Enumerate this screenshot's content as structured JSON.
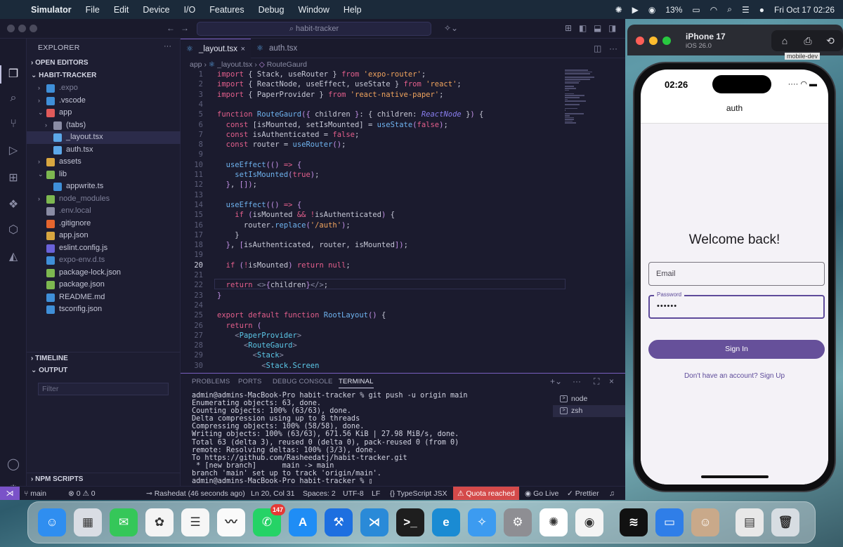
{
  "menubar": {
    "items": [
      "Simulator",
      "File",
      "Edit",
      "Device",
      "I/O",
      "Features",
      "Debug",
      "Window",
      "Help"
    ],
    "battery": "13%",
    "datetime": "Fri Oct 17  02:26"
  },
  "vscode": {
    "search": "habit-tracker",
    "explorer_title": "EXPLORER",
    "sections": {
      "open_editors": "OPEN EDITORS",
      "project": "HABIT-TRACKER",
      "timeline": "TIMELINE",
      "output": "OUTPUT",
      "npm": "NPM SCRIPTS"
    },
    "filter_placeholder": "Filter",
    "tree": [
      {
        "label": ".expo",
        "indent": 1,
        "chev": "›",
        "icon": "folder-icon",
        "color": "#3f8fd8",
        "dim": true
      },
      {
        "label": ".vscode",
        "indent": 1,
        "chev": "›",
        "icon": "folder-icon",
        "color": "#3f8fd8",
        "dim": false
      },
      {
        "label": "app",
        "indent": 1,
        "chev": "⌄",
        "icon": "folder-icon",
        "color": "#e05a5a",
        "dim": false
      },
      {
        "label": "(tabs)",
        "indent": 2,
        "chev": "›",
        "icon": "folder-icon",
        "color": "#8a8ca4",
        "dim": false
      },
      {
        "label": "_layout.tsx",
        "indent": 2,
        "chev": "",
        "icon": "react-icon",
        "color": "#5ca7e8",
        "dim": false,
        "selected": true
      },
      {
        "label": "auth.tsx",
        "indent": 2,
        "chev": "",
        "icon": "react-icon",
        "color": "#5ca7e8",
        "dim": false
      },
      {
        "label": "assets",
        "indent": 1,
        "chev": "›",
        "icon": "folder-icon",
        "color": "#d8a640",
        "dim": false
      },
      {
        "label": "lib",
        "indent": 1,
        "chev": "⌄",
        "icon": "folder-icon",
        "color": "#7db850",
        "dim": false
      },
      {
        "label": "appwrite.ts",
        "indent": 2,
        "chev": "",
        "icon": "ts-icon",
        "color": "#3f8fd8",
        "dim": false
      },
      {
        "label": "node_modules",
        "indent": 1,
        "chev": "›",
        "icon": "folder-icon",
        "color": "#7db850",
        "dim": true
      },
      {
        "label": ".env.local",
        "indent": 1,
        "chev": "",
        "icon": "env-icon",
        "color": "#8a8ca4",
        "dim": true
      },
      {
        "label": ".gitignore",
        "indent": 1,
        "chev": "",
        "icon": "git-icon",
        "color": "#e5652e",
        "dim": false
      },
      {
        "label": "app.json",
        "indent": 1,
        "chev": "",
        "icon": "json-icon",
        "color": "#d8a640",
        "dim": false
      },
      {
        "label": "eslint.config.js",
        "indent": 1,
        "chev": "",
        "icon": "eslint-icon",
        "color": "#6a62d8",
        "dim": false
      },
      {
        "label": "expo-env.d.ts",
        "indent": 1,
        "chev": "",
        "icon": "ts-icon",
        "color": "#3f8fd8",
        "dim": true
      },
      {
        "label": "package-lock.json",
        "indent": 1,
        "chev": "",
        "icon": "npm-icon",
        "color": "#7db850",
        "dim": false
      },
      {
        "label": "package.json",
        "indent": 1,
        "chev": "",
        "icon": "npm-icon",
        "color": "#7db850",
        "dim": false
      },
      {
        "label": "README.md",
        "indent": 1,
        "chev": "",
        "icon": "info-icon",
        "color": "#3f8fd8",
        "dim": false
      },
      {
        "label": "tsconfig.json",
        "indent": 1,
        "chev": "",
        "icon": "tsconfig-icon",
        "color": "#3f8fd8",
        "dim": false
      }
    ],
    "tabs": [
      {
        "label": "_layout.tsx",
        "active": true
      },
      {
        "label": "auth.tsx",
        "active": false
      }
    ],
    "breadcrumb": {
      "a": "app",
      "b": "_layout.tsx",
      "c": "RouteGaurd"
    },
    "code": [
      [
        [
          "k",
          "import "
        ],
        [
          "v",
          "{ "
        ],
        [
          "v",
          "Stack"
        ],
        [
          "v",
          ", "
        ],
        [
          "v",
          "useRouter"
        ],
        [
          "v",
          " } "
        ],
        [
          "k",
          "from "
        ],
        [
          "s",
          "'expo-router'"
        ],
        [
          "v",
          ";"
        ]
      ],
      [
        [
          "k",
          "import "
        ],
        [
          "v",
          "{ ReactNode, useEffect, useState } "
        ],
        [
          "k",
          "from "
        ],
        [
          "s",
          "'react'"
        ],
        [
          "v",
          ";"
        ]
      ],
      [
        [
          "k",
          "import "
        ],
        [
          "v",
          "{ PaperProvider } "
        ],
        [
          "k",
          "from "
        ],
        [
          "s",
          "'react-native-paper'"
        ],
        [
          "v",
          ";"
        ]
      ],
      [],
      [
        [
          "k",
          "function "
        ],
        [
          "f",
          "RouteGaurd"
        ],
        [
          "b",
          "({ "
        ],
        [
          "v",
          "children "
        ],
        [
          "b",
          "}"
        ],
        [
          "v",
          ": { children: "
        ],
        [
          "t",
          "ReactNode"
        ],
        [
          "v",
          " }"
        ],
        [
          "b",
          ")"
        ],
        [
          "v",
          " {"
        ]
      ],
      [
        [
          "v",
          "  "
        ],
        [
          "k",
          "const "
        ],
        [
          "v",
          "[isMounted, setIsMounted] = "
        ],
        [
          "f",
          "useState"
        ],
        [
          "b",
          "("
        ],
        [
          "k",
          "false"
        ],
        [
          "b",
          ")"
        ],
        [
          "v",
          ";"
        ]
      ],
      [
        [
          "v",
          "  "
        ],
        [
          "k",
          "const "
        ],
        [
          "v",
          "isAuthenticated = "
        ],
        [
          "k",
          "false"
        ],
        [
          "v",
          ";"
        ]
      ],
      [
        [
          "v",
          "  "
        ],
        [
          "k",
          "const "
        ],
        [
          "v",
          "router = "
        ],
        [
          "f",
          "useRouter"
        ],
        [
          "b",
          "()"
        ],
        [
          "v",
          ";"
        ]
      ],
      [],
      [
        [
          "v",
          "  "
        ],
        [
          "f",
          "useEffect"
        ],
        [
          "b",
          "(() "
        ],
        [
          "k",
          "=> "
        ],
        [
          "b",
          "{"
        ]
      ],
      [
        [
          "v",
          "    "
        ],
        [
          "f",
          "setIsMounted"
        ],
        [
          "b",
          "("
        ],
        [
          "k",
          "true"
        ],
        [
          "b",
          ")"
        ],
        [
          "v",
          ";"
        ]
      ],
      [
        [
          "v",
          "  "
        ],
        [
          "b",
          "}"
        ],
        [
          "v",
          ", "
        ],
        [
          "b",
          "[]"
        ],
        [
          "b",
          ")"
        ],
        [
          "v",
          ";"
        ]
      ],
      [],
      [
        [
          "v",
          "  "
        ],
        [
          "f",
          "useEffect"
        ],
        [
          "b",
          "(() "
        ],
        [
          "k",
          "=> "
        ],
        [
          "b",
          "{"
        ]
      ],
      [
        [
          "v",
          "    "
        ],
        [
          "k",
          "if "
        ],
        [
          "b",
          "("
        ],
        [
          "v",
          "isMounted "
        ],
        [
          "k",
          "&& "
        ],
        [
          "k",
          "!"
        ],
        [
          "v",
          "isAuthenticated"
        ],
        [
          "b",
          ")"
        ],
        [
          "v",
          " {"
        ]
      ],
      [
        [
          "v",
          "      router."
        ],
        [
          "f",
          "replace"
        ],
        [
          "b",
          "("
        ],
        [
          "s",
          "'/auth'"
        ],
        [
          "b",
          ")"
        ],
        [
          "v",
          ";"
        ]
      ],
      [
        [
          "v",
          "    }"
        ]
      ],
      [
        [
          "v",
          "  "
        ],
        [
          "b",
          "}"
        ],
        [
          "v",
          ", "
        ],
        [
          "b",
          "["
        ],
        [
          "v",
          "isAuthenticated, router, isMounted"
        ],
        [
          "b",
          "]"
        ],
        [
          "b",
          ")"
        ],
        [
          "v",
          ";"
        ]
      ],
      [],
      [
        [
          "v",
          "  "
        ],
        [
          "k",
          "if "
        ],
        [
          "b",
          "("
        ],
        [
          "k",
          "!"
        ],
        [
          "v",
          "isMounted"
        ],
        [
          "b",
          ")"
        ],
        [
          "v",
          " "
        ],
        [
          "k",
          "return "
        ],
        [
          "k",
          "null"
        ],
        [
          "v",
          ";"
        ]
      ],
      [],
      [
        [
          "v",
          "  "
        ],
        [
          "k",
          "return "
        ],
        [
          "p",
          "<>"
        ],
        [
          "b",
          "{"
        ],
        [
          "v",
          "children"
        ],
        [
          "b",
          "}"
        ],
        [
          "p",
          "</>"
        ],
        [
          "v",
          ";"
        ]
      ],
      [
        [
          "b",
          "}"
        ]
      ],
      [],
      [
        [
          "k",
          "export "
        ],
        [
          "k",
          "default "
        ],
        [
          "k",
          "function "
        ],
        [
          "f",
          "RootLayout"
        ],
        [
          "b",
          "()"
        ],
        [
          "v",
          " {"
        ]
      ],
      [
        [
          "v",
          "  "
        ],
        [
          "k",
          "return "
        ],
        [
          "b",
          "("
        ]
      ],
      [
        [
          "v",
          "    "
        ],
        [
          "p",
          "<"
        ],
        [
          "tg",
          "PaperProvider"
        ],
        [
          "p",
          ">"
        ]
      ],
      [
        [
          "v",
          "      "
        ],
        [
          "p",
          "<"
        ],
        [
          "tg",
          "RouteGaurd"
        ],
        [
          "p",
          ">"
        ]
      ],
      [
        [
          "v",
          "        "
        ],
        [
          "p",
          "<"
        ],
        [
          "tg",
          "Stack"
        ],
        [
          "p",
          ">"
        ]
      ],
      [
        [
          "v",
          "          "
        ],
        [
          "p",
          "<"
        ],
        [
          "tg",
          "Stack.Screen"
        ]
      ]
    ],
    "current_line": 20,
    "panel_tabs": [
      "PROBLEMS",
      "PORTS",
      "DEBUG CONSOLE",
      "TERMINAL"
    ],
    "terminal": [
      "admin@admins-MacBook-Pro habit-tracker % git push -u origin main",
      "Enumerating objects: 63, done.",
      "Counting objects: 100% (63/63), done.",
      "Delta compression using up to 8 threads",
      "Compressing objects: 100% (58/58), done.",
      "Writing objects: 100% (63/63), 671.56 KiB | 27.98 MiB/s, done.",
      "Total 63 (delta 3), reused 0 (delta 0), pack-reused 0 (from 0)",
      "remote: Resolving deltas: 100% (3/3), done.",
      "To https://github.com/Rasheedatj/habit-tracker.git",
      " * [new branch]      main -> main",
      "branch 'main' set up to track 'origin/main'.",
      "admin@admins-MacBook-Pro habit-tracker % ▯"
    ],
    "terminals": [
      "node",
      "zsh"
    ],
    "status": {
      "branch": "main",
      "problems": "⊗ 0 ⚠ 0",
      "blame": "Rashedat (46 seconds ago)",
      "position": "Ln 20, Col 31",
      "spaces": "Spaces: 2",
      "encoding": "UTF-8",
      "eol": "LF",
      "language": "TypeScript JSX",
      "quota": "Quota reached",
      "golive": "Go Live",
      "prettier": "Prettier"
    }
  },
  "simulator": {
    "device": "iPhone 17",
    "os": "iOS 26.0",
    "time": "02:26",
    "nav_title": "auth",
    "welcome": "Welcome back!",
    "email_placeholder": "Email",
    "password_label": "Password",
    "password_value": "••••••",
    "signin": "Sign In",
    "signup": "Don't have an account? Sign Up",
    "tooltip": "mobile-dev"
  },
  "dock": [
    {
      "name": "finder",
      "glyph": "☺",
      "bg": "#2f8ef0"
    },
    {
      "name": "launchpad",
      "glyph": "▦",
      "bg": "#d9dde4"
    },
    {
      "name": "messages",
      "glyph": "✉",
      "bg": "#35c759"
    },
    {
      "name": "photos",
      "glyph": "✿",
      "bg": "#f4f4f4"
    },
    {
      "name": "reminders",
      "glyph": "☰",
      "bg": "#f6f6f6"
    },
    {
      "name": "freeform",
      "glyph": "〰",
      "bg": "#fafafa"
    },
    {
      "name": "whatsapp",
      "glyph": "✆",
      "bg": "#25d366",
      "badge": "147"
    },
    {
      "name": "app-store",
      "glyph": "A",
      "bg": "#1f8df5"
    },
    {
      "name": "xcode",
      "glyph": "⚒",
      "bg": "#1d6fe0"
    },
    {
      "name": "vscode",
      "glyph": "⋊",
      "bg": "#2a8ad8"
    },
    {
      "name": "terminal",
      "glyph": ">_",
      "bg": "#1e1e1e"
    },
    {
      "name": "edge",
      "glyph": "e",
      "bg": "#1a8bd3"
    },
    {
      "name": "safari",
      "glyph": "✧",
      "bg": "#3c9bf0"
    },
    {
      "name": "system-settings",
      "glyph": "⚙",
      "bg": "#8e8e93"
    },
    {
      "name": "chatgpt",
      "glyph": "✺",
      "bg": "#ffffff"
    },
    {
      "name": "chrome",
      "glyph": "◉",
      "bg": "#f4f4f4"
    },
    {
      "name": "spotify",
      "glyph": "≋",
      "bg": "#111111"
    },
    {
      "name": "files",
      "glyph": "▭",
      "bg": "#2f7ee8"
    },
    {
      "name": "contacts",
      "glyph": "☺",
      "bg": "#c9a98a"
    },
    {
      "name": "preview",
      "glyph": "▤",
      "bg": "#e8e8e8"
    },
    {
      "name": "trash",
      "glyph": "🗑",
      "bg": "#d7dde2"
    }
  ]
}
